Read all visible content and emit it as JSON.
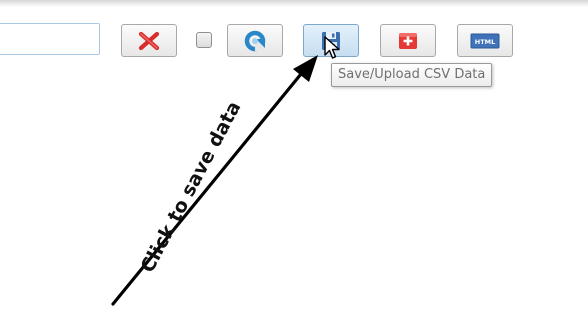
{
  "search": {
    "value": "",
    "placeholder": ""
  },
  "toolbar": {
    "buttons": [
      {
        "icon": "red-x-icon",
        "color": "#d92d2d"
      },
      {
        "icon": "refresh-icon",
        "color": "#2a87c9"
      },
      {
        "icon": "save-icon",
        "color": "#3b6fb0",
        "tooltip": "Save/Upload CSV Data"
      },
      {
        "icon": "add-plus-icon",
        "color": "#e53935"
      },
      {
        "icon": "html-icon",
        "color": "#3f72b8",
        "label": "HTML"
      }
    ],
    "checkbox_checked": false
  },
  "tooltip": {
    "text": "Save/Upload CSV Data"
  },
  "annotation": {
    "text": "Click to save data",
    "color": "#111111"
  }
}
